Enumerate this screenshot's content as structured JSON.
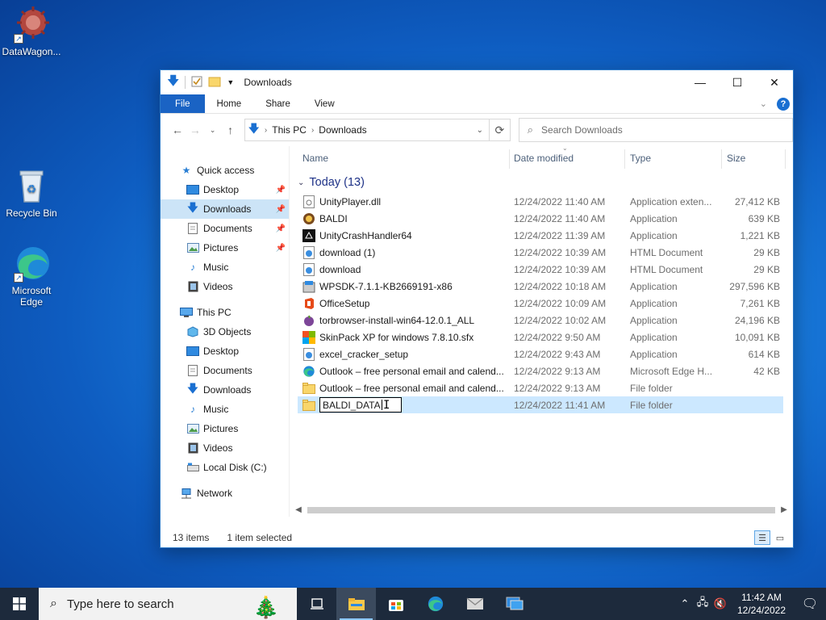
{
  "desktop": {
    "icons": [
      {
        "label": "DataWagon...",
        "icon": "gear-virus-icon"
      },
      {
        "label": "Recycle Bin",
        "icon": "recycle-bin-icon"
      },
      {
        "label": "Microsoft Edge",
        "icon": "edge-icon"
      }
    ]
  },
  "window": {
    "title": "Downloads",
    "controls": {
      "minimize": "—",
      "maximize": "☐",
      "close": "✕"
    },
    "ribbon_tabs": [
      "File",
      "Home",
      "Share",
      "View"
    ],
    "address": {
      "crumbs": [
        "This PC",
        "Downloads"
      ]
    },
    "search_placeholder": "Search Downloads",
    "columns": {
      "name": "Name",
      "date": "Date modified",
      "type": "Type",
      "size": "Size"
    },
    "group_label": "Today (13)",
    "nav": {
      "quick_access": "Quick access",
      "quick_items": [
        "Desktop",
        "Downloads",
        "Documents",
        "Pictures",
        "Music",
        "Videos"
      ],
      "this_pc": "This PC",
      "pc_items": [
        "3D Objects",
        "Desktop",
        "Documents",
        "Downloads",
        "Music",
        "Pictures",
        "Videos",
        "Local Disk (C:)"
      ],
      "network": "Network"
    },
    "files": [
      {
        "name": "UnityPlayer.dll",
        "date": "12/24/2022 11:40 AM",
        "type": "Application exten...",
        "size": "27,412 KB",
        "icon": "dll-icon"
      },
      {
        "name": "BALDI",
        "date": "12/24/2022 11:40 AM",
        "type": "Application",
        "size": "639 KB",
        "icon": "baldi-app-icon"
      },
      {
        "name": "UnityCrashHandler64",
        "date": "12/24/2022 11:39 AM",
        "type": "Application",
        "size": "1,221 KB",
        "icon": "unity-icon"
      },
      {
        "name": "download (1)",
        "date": "12/24/2022 10:39 AM",
        "type": "HTML Document",
        "size": "29 KB",
        "icon": "html-doc-icon"
      },
      {
        "name": "download",
        "date": "12/24/2022 10:39 AM",
        "type": "HTML Document",
        "size": "29 KB",
        "icon": "html-doc-icon"
      },
      {
        "name": "WPSDK-7.1.1-KB2669191-x86",
        "date": "12/24/2022 10:18 AM",
        "type": "Application",
        "size": "297,596 KB",
        "icon": "installer-icon"
      },
      {
        "name": "OfficeSetup",
        "date": "12/24/2022 10:09 AM",
        "type": "Application",
        "size": "7,261 KB",
        "icon": "office-icon"
      },
      {
        "name": "torbrowser-install-win64-12.0.1_ALL",
        "date": "12/24/2022 10:02 AM",
        "type": "Application",
        "size": "24,196 KB",
        "icon": "tor-icon"
      },
      {
        "name": "SkinPack XP for windows 7.8.10.sfx",
        "date": "12/24/2022 9:50 AM",
        "type": "Application",
        "size": "10,091 KB",
        "icon": "skinpack-icon"
      },
      {
        "name": "excel_cracker_setup",
        "date": "12/24/2022 9:43 AM",
        "type": "Application",
        "size": "614 KB",
        "icon": "setup-icon"
      },
      {
        "name": "Outlook – free personal email and calend...",
        "date": "12/24/2022 9:13 AM",
        "type": "Microsoft Edge H...",
        "size": "42 KB",
        "icon": "edge-icon"
      },
      {
        "name": "Outlook – free personal email and calend...",
        "date": "12/24/2022 9:13 AM",
        "type": "File folder",
        "size": "",
        "icon": "folder-icon"
      }
    ],
    "renaming": {
      "value": "BALDI_DATA",
      "date": "12/24/2022 11:41 AM",
      "type": "File folder",
      "icon": "folder-icon"
    },
    "status": {
      "count": "13 items",
      "selected": "1 item selected"
    }
  },
  "taskbar": {
    "search_placeholder": "Type here to search",
    "time": "11:42 AM",
    "date": "12/24/2022"
  }
}
